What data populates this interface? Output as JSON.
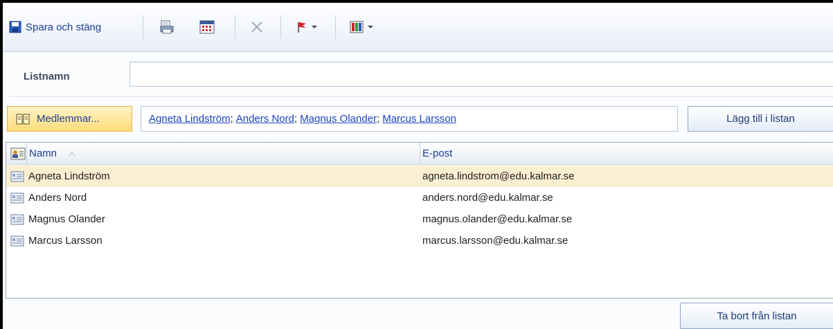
{
  "toolbar": {
    "save_label": "Spara och stäng",
    "icons": [
      "save-icon",
      "print-icon",
      "calendar-icon",
      "delete-icon",
      "flag-icon",
      "categorize-icon"
    ]
  },
  "list_name": {
    "label": "Listnamn",
    "value": ""
  },
  "members": {
    "button_label": "Medlemmar...",
    "names": [
      "Agneta Lindström",
      "Anders Nord",
      "Magnus Olander",
      "Marcus Larsson"
    ],
    "separator": ";",
    "add_button": "Lägg till i listan"
  },
  "grid": {
    "columns": {
      "name": "Namn",
      "email": "E-post"
    },
    "rows": [
      {
        "name": "Agneta Lindström",
        "email": "agneta.lindstrom@edu.kalmar.se",
        "selected": true
      },
      {
        "name": "Anders Nord",
        "email": "anders.nord@edu.kalmar.se",
        "selected": false
      },
      {
        "name": "Magnus Olander",
        "email": "magnus.olander@edu.kalmar.se",
        "selected": false
      },
      {
        "name": "Marcus Larsson",
        "email": "marcus.larsson@edu.kalmar.se",
        "selected": false
      }
    ]
  },
  "remove_button": "Ta bort från listan",
  "colors": {
    "link": "#1d44b8",
    "selected_row": "#fbefd2",
    "accent": "#1c3f94"
  }
}
